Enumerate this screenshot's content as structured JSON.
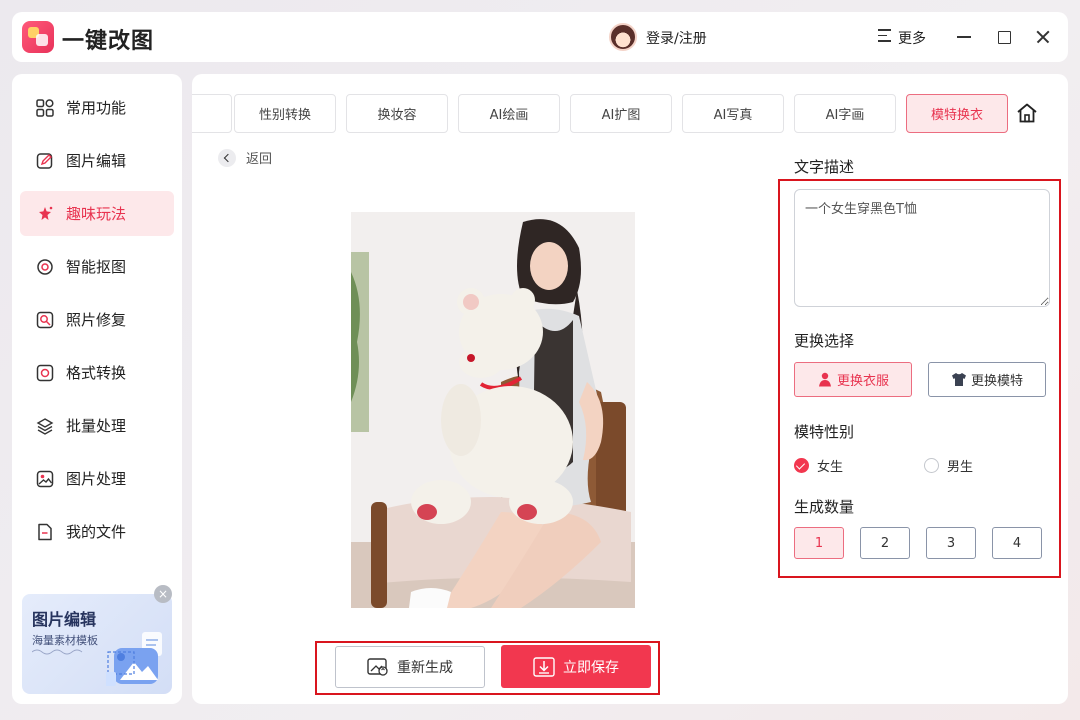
{
  "app": {
    "title": "一键改图"
  },
  "header": {
    "login": "登录/注册",
    "more": "更多"
  },
  "sidebar": {
    "items": [
      {
        "label": "常用功能",
        "icon": "grid-icon"
      },
      {
        "label": "图片编辑",
        "icon": "edit-icon"
      },
      {
        "label": "趣味玩法",
        "icon": "sparkle-icon",
        "active": true
      },
      {
        "label": "智能抠图",
        "icon": "target-icon"
      },
      {
        "label": "照片修复",
        "icon": "repair-icon"
      },
      {
        "label": "格式转换",
        "icon": "convert-icon"
      },
      {
        "label": "批量处理",
        "icon": "layers-icon"
      },
      {
        "label": "图片处理",
        "icon": "image-icon"
      },
      {
        "label": "我的文件",
        "icon": "file-icon"
      }
    ],
    "promo": {
      "title": "图片编辑",
      "subtitle": "海量素材模板"
    }
  },
  "tabs": [
    "性别转换",
    "换妆容",
    "AI绘画",
    "AI扩图",
    "AI写真",
    "AI字画",
    "模特换衣"
  ],
  "active_tab": "模特换衣",
  "back_label": "返回",
  "actions": {
    "regenerate": "重新生成",
    "save": "立即保存"
  },
  "settings": {
    "desc_title": "文字描述",
    "desc_value": "一个女生穿黑色T恤",
    "replace_title": "更换选择",
    "replace_options": [
      "更换衣服",
      "更换模特"
    ],
    "replace_selected": "更换衣服",
    "gender_title": "模特性别",
    "gender_options": [
      "女生",
      "男生"
    ],
    "gender_selected": "女生",
    "count_title": "生成数量",
    "count_options": [
      "1",
      "2",
      "3",
      "4"
    ],
    "count_selected": "1"
  },
  "colors": {
    "accent": "#f2374f",
    "accent_light": "#fde8ea",
    "highlight_border": "#d9151e"
  }
}
